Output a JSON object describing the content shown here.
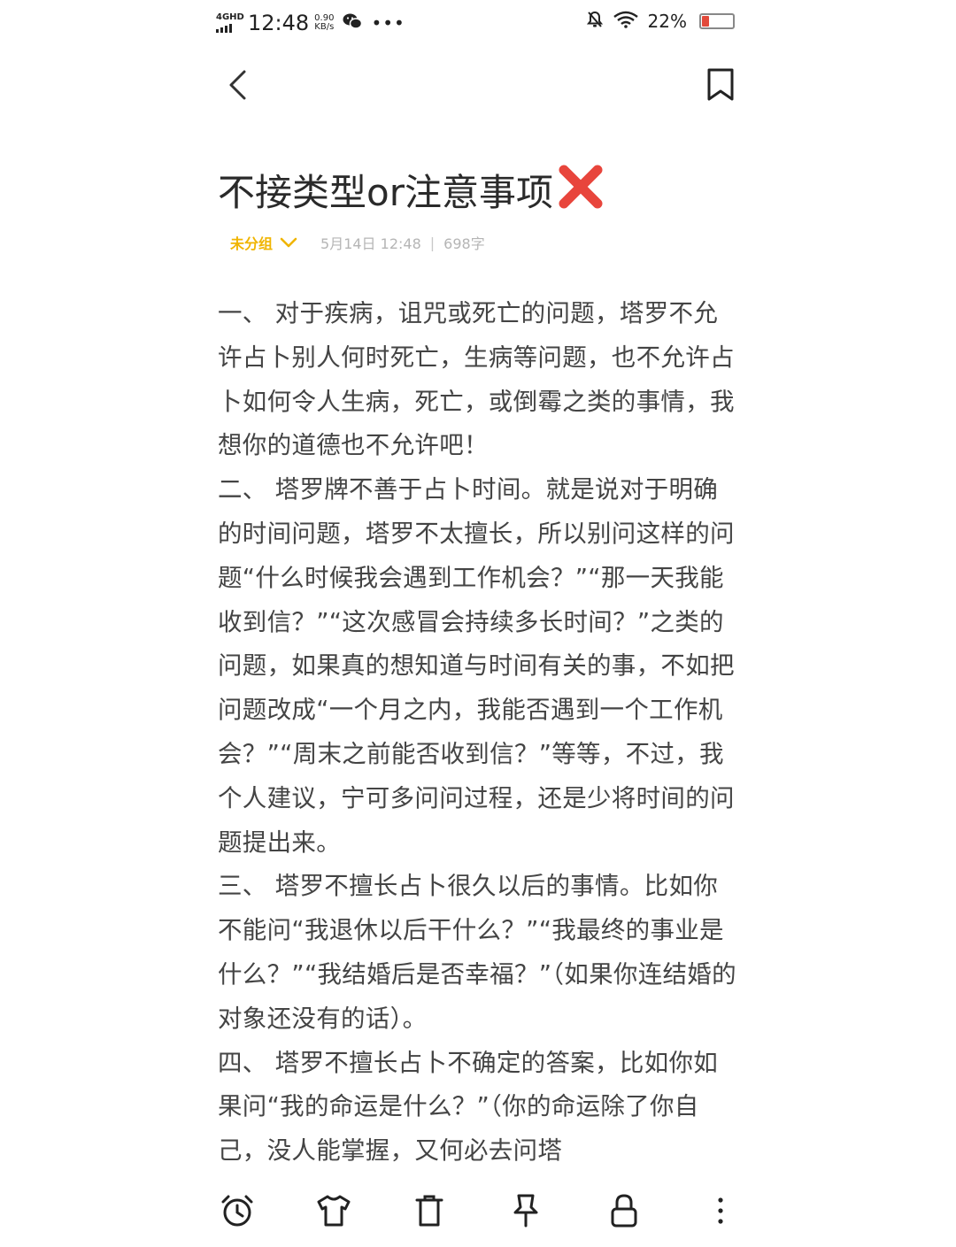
{
  "status_bar": {
    "network": "4GHD",
    "time": "12:48",
    "speed_value": "0.90",
    "speed_unit": "KB/s",
    "more": "•••",
    "battery": "22%",
    "battery_level": 0.22,
    "battery_fill_color": "#e24a3b"
  },
  "note": {
    "title": "不接类型or注意事项",
    "title_emoji_icon": "red-cross-mark-icon",
    "group": "未分组",
    "date": "5月14日 12:48",
    "separator": "|",
    "word_count": "698字",
    "paragraphs": [
      "一、 对于疾病，诅咒或死亡的问题，塔罗不允许占卜别人何时死亡，生病等问题，也不允许占卜如何令人生病，死亡，或倒霉之类的事情，我想你的道德也不允许吧！",
      "二、 塔罗牌不善于占卜时间。就是说对于明确的时间问题，塔罗不太擅长，所以别问这样的问题“什么时候我会遇到工作机会？”“那一天我能收到信？”“这次感冒会持续多长时间？”之类的问题，如果真的想知道与时间有关的事，不如把问题改成“一个月之内，我能否遇到一个工作机会？”“周末之前能否收到信？”等等，不过，我个人建议，宁可多问问过程，还是少将时间的问题提出来。",
      "三、 塔罗不擅长占卜很久以后的事情。比如你不能问“我退休以后干什么？”“我最终的事业是什么？”“我结婚后是否幸福？”（如果你连结婚的对象还没有的话）。",
      "四、 塔罗不擅长占卜不确定的答案，比如你如果问“我的命运是什么？”（你的命运除了你自己，没人能掌握，又何必去问塔"
    ]
  },
  "colors": {
    "group_accent": "#f0b400",
    "meta_text": "#b5b5b5",
    "body_text": "#444444"
  },
  "toolbar": {
    "icons": [
      "alarm-clock-icon",
      "tshirt-icon",
      "trash-icon",
      "pin-icon",
      "lock-icon",
      "more-vertical-icon"
    ]
  }
}
